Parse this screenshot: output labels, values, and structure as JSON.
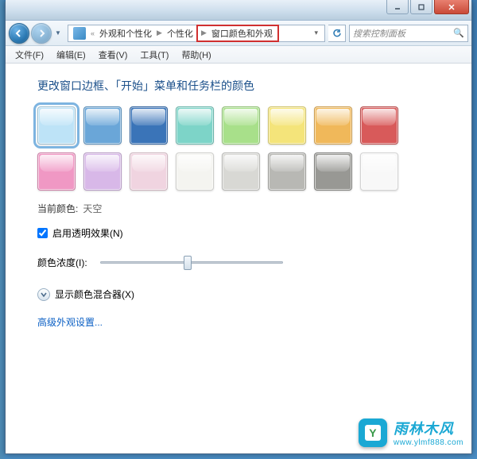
{
  "titlebar": {
    "min": "—",
    "max": "☐",
    "close": "✕"
  },
  "nav": {
    "prefix": "«",
    "crumbs": [
      "外观和个性化",
      "个性化",
      "窗口颜色和外观"
    ],
    "refresh": "↻",
    "search_placeholder": "搜索控制面板"
  },
  "menu": [
    "文件(F)",
    "编辑(E)",
    "查看(V)",
    "工具(T)",
    "帮助(H)"
  ],
  "heading": "更改窗口边框、「开始」菜单和任务栏的颜色",
  "colors": [
    {
      "name": "天空",
      "hex": "#bde3f7",
      "sel": true
    },
    {
      "name": "浅蓝",
      "hex": "#6aa6d8",
      "sel": false
    },
    {
      "name": "蓝",
      "hex": "#3a74b8",
      "sel": false
    },
    {
      "name": "青",
      "hex": "#7dd4c8",
      "sel": false
    },
    {
      "name": "绿",
      "hex": "#a8e08a",
      "sel": false
    },
    {
      "name": "黄",
      "hex": "#f4e47a",
      "sel": false
    },
    {
      "name": "橙",
      "hex": "#f0b85a",
      "sel": false
    },
    {
      "name": "红",
      "hex": "#d85a5a",
      "sel": false
    },
    {
      "name": "粉",
      "hex": "#f098c4",
      "sel": false
    },
    {
      "name": "淡紫",
      "hex": "#d8b8e8",
      "sel": false
    },
    {
      "name": "淡粉",
      "hex": "#f0d4e0",
      "sel": false
    },
    {
      "name": "白",
      "hex": "#f4f4f0",
      "sel": false
    },
    {
      "name": "浅灰",
      "hex": "#d8d8d4",
      "sel": false
    },
    {
      "name": "灰",
      "hex": "#b8b8b4",
      "sel": false
    },
    {
      "name": "深灰",
      "hex": "#989894",
      "sel": false
    },
    {
      "name": "霜",
      "hex": "#f8f8f8",
      "sel": false
    }
  ],
  "current_label": "当前颜色:",
  "current_value": "天空",
  "transparency": {
    "label": "启用透明效果(N)",
    "checked": true
  },
  "intensity": {
    "label": "颜色浓度(I):",
    "value": 48
  },
  "mixer": {
    "label": "显示颜色混合器(X)"
  },
  "advanced_link": "高级外观设置...",
  "watermark": {
    "cn": "雨林木风",
    "url": "www.ylmf888.com"
  }
}
